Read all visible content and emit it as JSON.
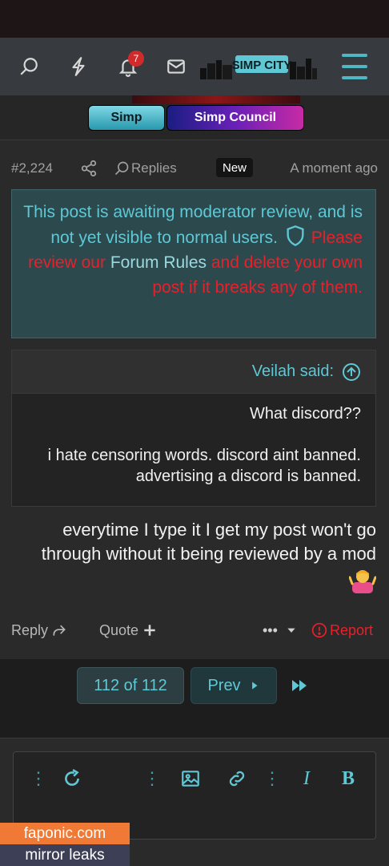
{
  "nav": {
    "notification_count": "7",
    "logo_text": "SIMP CITY"
  },
  "roles": {
    "simp": "Simp",
    "council": "Simp Council"
  },
  "post": {
    "date": "A moment ago",
    "new_badge": "New",
    "replies_label": "Replies",
    "number": "#2,224",
    "mod_notice": {
      "line_part1": "This post is awaiting moderator review, and is not yet visible to normal users.",
      "link_prefix": "Please review our",
      "link_text": "Forum Rules",
      "line_part2": "and delete your own post if it breaks any of them."
    },
    "quote": {
      "author": "Veilah said:",
      "line1": "What discord??",
      "line2": "i hate censoring words. discord aint banned. advertising a discord is banned."
    },
    "text": "everytime I type it I get my post won't go through without it being reviewed by a mod",
    "actions": {
      "report": "Report",
      "more": "•••",
      "quote": "Quote",
      "reply": "Reply"
    }
  },
  "pager": {
    "count": "112 of 112",
    "prev": "Prev"
  },
  "watermark": {
    "line1": "faponic.com",
    "line2": "mirror leaks"
  },
  "colors": {
    "accent": "#5fc8d4",
    "danger": "#e8202a",
    "notice_bg": "#2c4a4e"
  }
}
